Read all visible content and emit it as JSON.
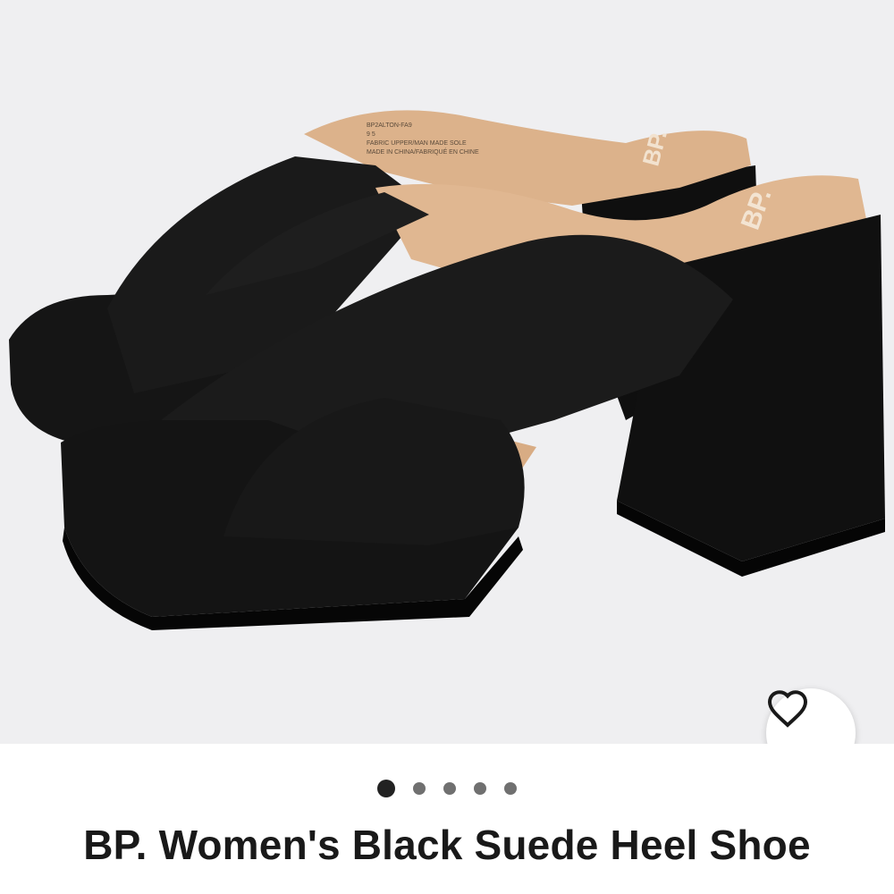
{
  "product": {
    "title": "BP. Women's Black Suede Heel Shoe",
    "image": {
      "alt": "Pair of black suede platform block-heel mule sandals",
      "insole_brand_mark": "BP.",
      "insole_label_lines": [
        "BP2ALTON-FA9",
        "9 5",
        "FABRIC UPPER/MAN MADE SOLE",
        "MADE IN CHINA/FABRIQUÉ EN CHINE"
      ]
    }
  },
  "gallery": {
    "count": 5,
    "active_index": 0
  },
  "favorite": {
    "icon": "heart-outline-icon"
  },
  "colors": {
    "background": "#efeff1",
    "shoe": "#121212",
    "insole": "#dfb68f",
    "dot_active": "#222222",
    "dot_inactive": "#707070"
  }
}
